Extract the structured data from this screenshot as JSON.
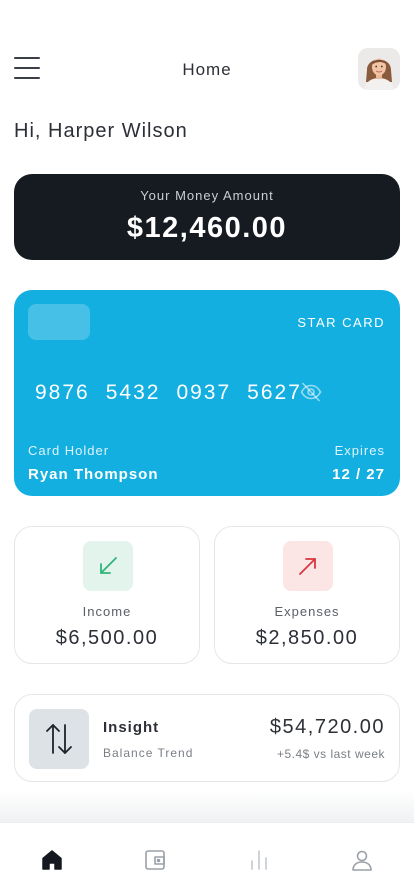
{
  "header": {
    "title": "Home",
    "menu_icon": "menu-icon",
    "avatar_icon": "user-avatar"
  },
  "greeting": "Hi, Harper Wilson",
  "balance": {
    "label": "Your Money Amount",
    "value": "$12,460.00"
  },
  "card": {
    "brand": "STAR CARD",
    "number": [
      "9876",
      "5432",
      "0937",
      "5627"
    ],
    "holder_label": "Card Holder",
    "holder_name": "Ryan Thompson",
    "expires_label": "Expires",
    "expires_value": "12 / 27",
    "color": "#14afe1"
  },
  "stats": {
    "income": {
      "label": "Income",
      "value": "$6,500.00",
      "color": "#2fb57a"
    },
    "expenses": {
      "label": "Expenses",
      "value": "$2,850.00",
      "color": "#d9363e"
    }
  },
  "insight": {
    "title": "Insight",
    "subtitle": "Balance Trend",
    "value": "$54,720.00",
    "trend": "+5.4$ vs last week"
  },
  "nav": {
    "items": [
      "home-icon",
      "wallet-icon",
      "bar-chart-icon",
      "profile-icon"
    ],
    "active": "home-icon"
  }
}
